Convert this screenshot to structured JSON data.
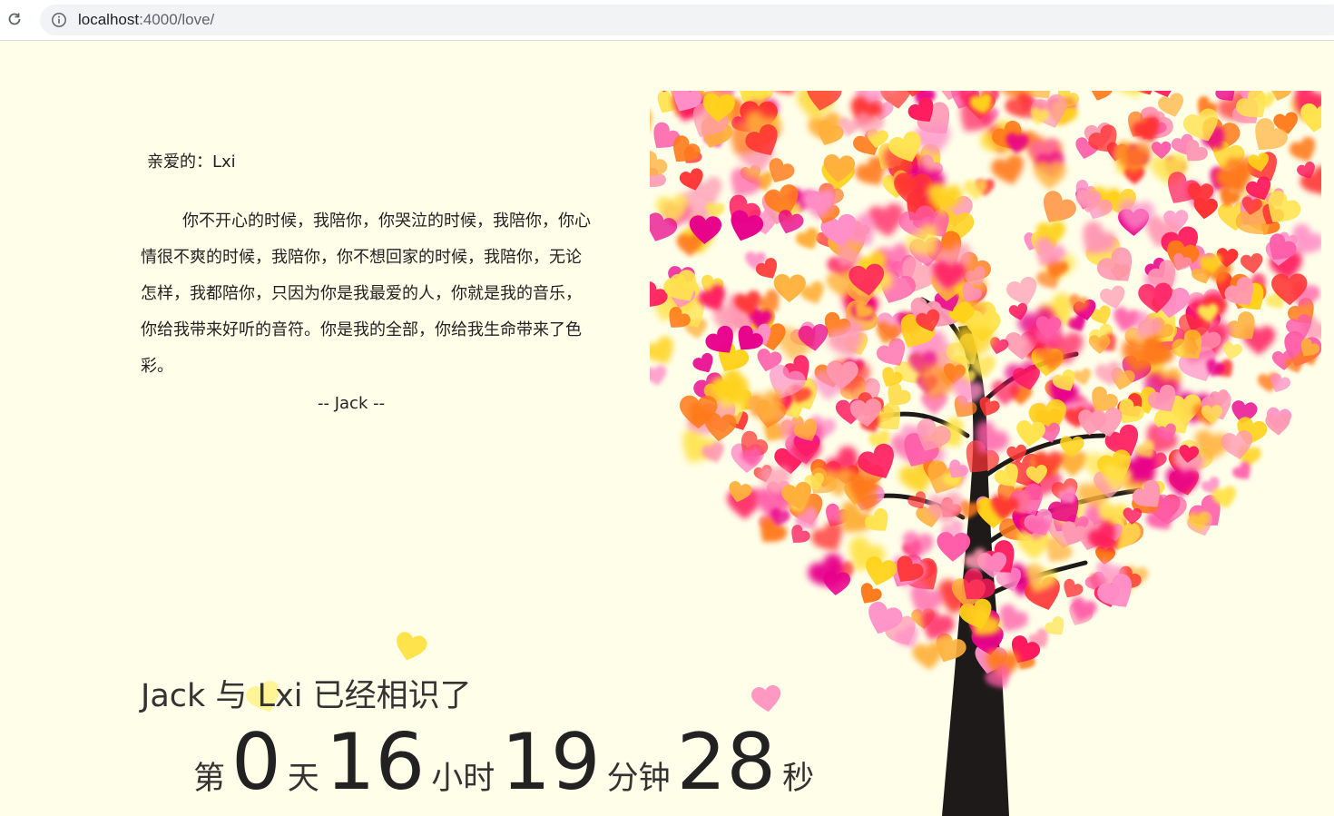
{
  "browser": {
    "url_host": "localhost",
    "url_rest": ":4000/love/",
    "icons": {
      "reload": "reload-icon",
      "info": "info-icon"
    }
  },
  "letter": {
    "greeting": "亲爱的：Lxi",
    "body": "你不开心的时候，我陪你，你哭泣的时候，我陪你，你心情很不爽的时候，我陪你，你不想回家的时候，我陪你，无论怎样，我都陪你，只因为你是我最爱的人，你就是我的音乐，你给我带来好听的音符。你是我的全部，你给我生命带来了色彩。",
    "signature": "-- Jack --"
  },
  "counter": {
    "title": "Jack 与 Lxi 已经相识了",
    "prefix": "第",
    "days": "0",
    "days_unit": "天",
    "hours": "16",
    "hours_unit": "小时",
    "minutes": "19",
    "minutes_unit": "分钟",
    "seconds": "28",
    "seconds_unit": "秒"
  },
  "colors": {
    "background": "#fffee9",
    "trunk": "#1e1a1a",
    "heart_palette": [
      "#ff1a5e",
      "#ff5ca8",
      "#ff7a1a",
      "#ffd21a",
      "#ff3333",
      "#ff8fc7",
      "#ffb03b",
      "#e8008c",
      "#ffe34d",
      "#ff99b3"
    ]
  }
}
